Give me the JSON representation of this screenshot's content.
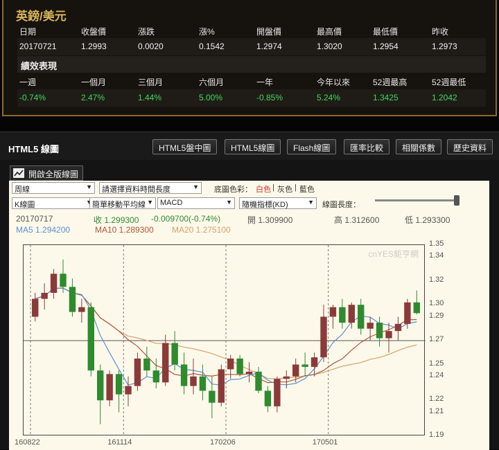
{
  "quote": {
    "title": "英鎊/美元",
    "headers": [
      "日期",
      "收盤價",
      "漲跌",
      "漲%",
      "開盤價",
      "最高價",
      "最低價",
      "昨收"
    ],
    "values": [
      "20170721",
      "1.2993",
      "0.0020",
      "0.1542",
      "1.2974",
      "1.3020",
      "1.2954",
      "1.2973"
    ],
    "perf_title": "績效表現",
    "perf_headers": [
      "一週",
      "一個月",
      "三個月",
      "六個月",
      "一年",
      "今年以來",
      "52週最高",
      "52週最低"
    ],
    "perf_values": [
      "-0.74%",
      "2.47%",
      "1.44%",
      "5.00%",
      "-0.85%",
      "5.24%",
      "1.3425",
      "1.2042"
    ]
  },
  "chart_panel": {
    "title": "HTML5 線圖",
    "tabs": [
      "HTML5盤中圖",
      "HTML5線圖",
      "Flash線圖",
      "匯率比較",
      "相關係數",
      "歷史資料"
    ],
    "fullscreen_label": "開啟全版線圖"
  },
  "controls": {
    "period": "周線",
    "range_placeholder": "請選擇資料時間長度",
    "bg_label": "底圖色彩：",
    "bg_options": [
      "白色",
      "灰色",
      "藍色"
    ],
    "chart_type": "K線圖",
    "ma_type": "簡單移動平均線",
    "indicator1": "MACD",
    "indicator2": "隨機指標(KD)",
    "length_label": "線圖長度："
  },
  "info": {
    "date": "20170717",
    "close": "收 1.299300",
    "change": "-0.009700(-0.74%)",
    "open": "開 1.309900",
    "high": "高 1.312600",
    "low": "低 1.293300",
    "ma5": "MA5 1.294200",
    "ma10": "MA10 1.289300",
    "ma20": "MA20 1.275100",
    "watermark": "cnYES鉅亨網"
  },
  "colors": {
    "up": "#8b3a3a",
    "down": "#2e8b2e",
    "ma5": "#5b8fd6",
    "ma10": "#b2553a",
    "ma20": "#d6a26a"
  },
  "chart_data": {
    "type": "candlestick",
    "ylim": [
      1.19,
      1.35
    ],
    "y_ticks": [
      "1.35",
      "1.34",
      "1.32",
      "1.30",
      "1.29",
      "1.27",
      "1.25",
      "1.24",
      "1.22",
      "1.21",
      "1.19"
    ],
    "x_ticks": [
      "160822",
      "161114",
      "170206",
      "170501"
    ],
    "ref_line": 1.27,
    "candles": [
      [
        1.29,
        1.31,
        1.286,
        1.305
      ],
      [
        1.305,
        1.318,
        1.296,
        1.31
      ],
      [
        1.31,
        1.33,
        1.305,
        1.326
      ],
      [
        1.326,
        1.338,
        1.31,
        1.315
      ],
      [
        1.315,
        1.322,
        1.29,
        1.294
      ],
      [
        1.294,
        1.305,
        1.285,
        1.298
      ],
      [
        1.298,
        1.302,
        1.24,
        1.245
      ],
      [
        1.245,
        1.25,
        1.2,
        1.22
      ],
      [
        1.22,
        1.245,
        1.215,
        1.242
      ],
      [
        1.242,
        1.245,
        1.21,
        1.225
      ],
      [
        1.225,
        1.24,
        1.215,
        1.232
      ],
      [
        1.232,
        1.26,
        1.228,
        1.255
      ],
      [
        1.255,
        1.265,
        1.24,
        1.245
      ],
      [
        1.245,
        1.255,
        1.23,
        1.235
      ],
      [
        1.235,
        1.275,
        1.232,
        1.268
      ],
      [
        1.268,
        1.278,
        1.245,
        1.25
      ],
      [
        1.25,
        1.26,
        1.225,
        1.232
      ],
      [
        1.232,
        1.255,
        1.225,
        1.24
      ],
      [
        1.24,
        1.25,
        1.22,
        1.228
      ],
      [
        1.228,
        1.24,
        1.205,
        1.218
      ],
      [
        1.218,
        1.25,
        1.215,
        1.246
      ],
      [
        1.246,
        1.258,
        1.238,
        1.255
      ],
      [
        1.255,
        1.258,
        1.24,
        1.242
      ],
      [
        1.242,
        1.252,
        1.235,
        1.244
      ],
      [
        1.244,
        1.248,
        1.226,
        1.228
      ],
      [
        1.228,
        1.232,
        1.21,
        1.215
      ],
      [
        1.215,
        1.24,
        1.21,
        1.238
      ],
      [
        1.238,
        1.245,
        1.23,
        1.24
      ],
      [
        1.24,
        1.255,
        1.235,
        1.25
      ],
      [
        1.25,
        1.26,
        1.24,
        1.248
      ],
      [
        1.248,
        1.26,
        1.24,
        1.256
      ],
      [
        1.256,
        1.3,
        1.252,
        1.29
      ],
      [
        1.29,
        1.3,
        1.28,
        1.298
      ],
      [
        1.298,
        1.305,
        1.28,
        1.285
      ],
      [
        1.285,
        1.302,
        1.28,
        1.3
      ],
      [
        1.3,
        1.305,
        1.275,
        1.28
      ],
      [
        1.28,
        1.29,
        1.27,
        1.285
      ],
      [
        1.285,
        1.29,
        1.265,
        1.272
      ],
      [
        1.272,
        1.285,
        1.26,
        1.278
      ],
      [
        1.278,
        1.29,
        1.27,
        1.284
      ],
      [
        1.284,
        1.305,
        1.28,
        1.302
      ],
      [
        1.302,
        1.312,
        1.292,
        1.293
      ]
    ]
  }
}
